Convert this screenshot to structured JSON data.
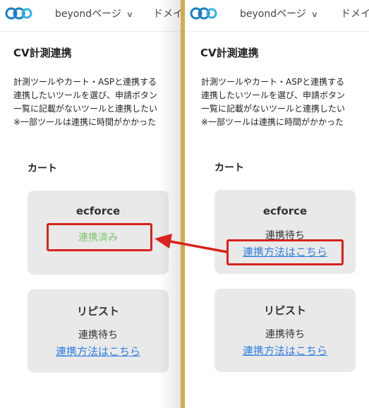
{
  "colors": {
    "accent_link": "#2f7fe3",
    "success": "#7bc46a",
    "highlight": "#d8221b",
    "divider": "#d1ad4c"
  },
  "icons": {
    "logo": "infinity-logo",
    "dropdown": "chevron-down-icon"
  },
  "header": {
    "site_label": "beyondページ",
    "domain_label": "ドメイ"
  },
  "page": {
    "title": "CV計測連携",
    "description": [
      "計測ツールやカート・ASPと連携する",
      "連携したいツールを選び、申請ボタン",
      "一覧に記載がないツールと連携したい",
      "※一部ツールは連携に時間がかかった"
    ],
    "section_title": "カート"
  },
  "left": {
    "cards": [
      {
        "name": "ecforce",
        "status": "連携済み"
      },
      {
        "name": "リピスト",
        "status": "連携待ち",
        "link": "連携方法はこちら"
      }
    ]
  },
  "right": {
    "cards": [
      {
        "name": "ecforce",
        "status": "連携待ち",
        "link": "連携方法はこちら"
      },
      {
        "name": "リピスト",
        "status": "連携待ち",
        "link": "連携方法はこちら"
      }
    ]
  }
}
